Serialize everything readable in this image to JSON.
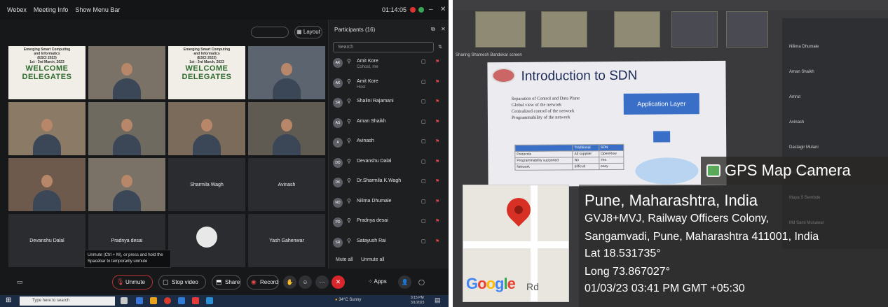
{
  "webex": {
    "menu": [
      "Webex",
      "Meeting Info",
      "Show Menu Bar"
    ],
    "clock": "01:14:05",
    "layout_label": "Layout",
    "tiles": [
      {
        "type": "slide",
        "lines": [
          "Emerging Smart Computing",
          "and Informatics",
          "(ESCI 2023)",
          "1st - 3rd March, 2023"
        ],
        "big": "WELCOME DELEGATES"
      },
      {
        "type": "cam"
      },
      {
        "type": "slide",
        "lines": [
          "Emerging Smart Computing",
          "and Informatics",
          "(ESCI 2023)",
          "1st - 3rd March, 2023"
        ],
        "big": "WELCOME DELEGATES"
      },
      {
        "type": "cam"
      },
      {
        "type": "cam"
      },
      {
        "type": "cam"
      },
      {
        "type": "cam"
      },
      {
        "type": "cam"
      },
      {
        "type": "cam"
      },
      {
        "type": "cam"
      },
      {
        "type": "name",
        "name": "Sharmila Wagh"
      },
      {
        "type": "name",
        "name": "Avinash"
      },
      {
        "type": "name",
        "name": "Devanshu Dalal"
      },
      {
        "type": "name",
        "name": "Pradnya desai"
      },
      {
        "type": "avatar"
      },
      {
        "type": "name",
        "name": "Yash Gahenwar"
      }
    ],
    "participants": {
      "header": "Participants (16)",
      "search_placeholder": "Search",
      "list": [
        {
          "initials": "AK",
          "name": "Amit Kore",
          "sub": "Cohost, me"
        },
        {
          "initials": "AK",
          "name": "Amit Kore",
          "sub": "Host"
        },
        {
          "initials": "SR",
          "name": "Shalini Rajamani",
          "sub": ""
        },
        {
          "initials": "AS",
          "name": "Aman Shaikh",
          "sub": ""
        },
        {
          "initials": "A",
          "name": "Avinash",
          "sub": ""
        },
        {
          "initials": "DD",
          "name": "Devanshu Dalal",
          "sub": ""
        },
        {
          "initials": "DK",
          "name": "Dr.Sharmila K.Wagh",
          "sub": ""
        },
        {
          "initials": "ND",
          "name": "Nilima Dhumale",
          "sub": ""
        },
        {
          "initials": "PD",
          "name": "Pradnya desai",
          "sub": ""
        },
        {
          "initials": "SR",
          "name": "Satayush Rai",
          "sub": ""
        }
      ],
      "mute_all": "Mute all",
      "unmute_all": "Unmute all"
    },
    "tooltip": "Unmute (Ctrl + M), or press and hold the Spacebar to temporarily unmute",
    "controls": {
      "unmute": "Unmute",
      "stop_video": "Stop video",
      "share": "Share",
      "record": "Record",
      "apps": "Apps"
    },
    "taskbar": {
      "search": "Type here to search",
      "weather": "34°C  Sunny",
      "time": "3:15 PM",
      "date": "3/1/2023"
    }
  },
  "photo": {
    "slide_title": "Introduction to SDN",
    "bullets": [
      "Separation of Control and Data Plane",
      "Global view of the network",
      "Centralized control of the network",
      "Programmability of the network"
    ],
    "app_layer": "Application Layer",
    "table": [
      [
        "",
        "Traditional",
        "SDN"
      ],
      [
        "Protocols",
        "All supplier",
        "OpenFlow"
      ],
      [
        "Programmability supported",
        "No",
        "Yes"
      ],
      [
        "Network",
        "difficult",
        "easy"
      ]
    ],
    "presenter_strip": "Sharing Shamesh Bandekar screen",
    "right_list": [
      "Nilima Dhumale",
      "Aman Shaikh",
      "Amrut",
      "Avinash",
      "Dastagir Mulani",
      "Dr.Vidya Patkar",
      "Maya S Bembde",
      "Md Sami Musawar"
    ],
    "gps": {
      "title": "GPS Map Camera",
      "city": "Pune, Maharashtra, India",
      "addr1": "GVJ8+MVJ, Railway Officers Colony,",
      "addr2": "Sangamvadi, Pune, Maharashtra 411001, India",
      "lat": "Lat 18.531735°",
      "long": "Long 73.867027°",
      "datetime": "01/03/23 03:41 PM GMT +05:30",
      "map_brand": "Google",
      "road": "Rd"
    }
  }
}
